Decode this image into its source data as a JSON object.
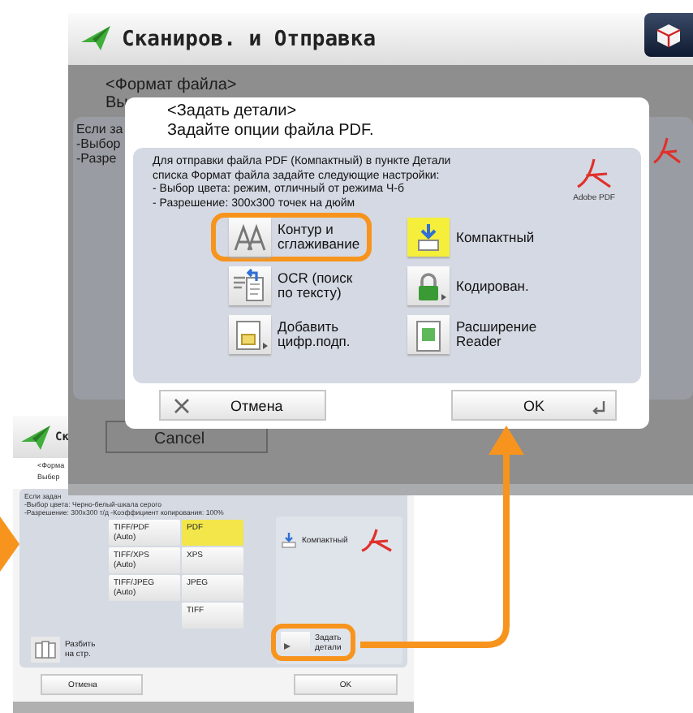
{
  "inset_screen": {
    "title": "Ск",
    "format_label": "<Форма",
    "choose_label": "Выбер",
    "note_lines": [
      "Если задан",
      "-Выбор цвета: Черно-белый-шкала серого",
      "-Разрешение: 300x300 т/д -Коэффициент копирования: 100%"
    ],
    "formats": [
      {
        "label": "TIFF/PDF\n(Auto)",
        "selected": false
      },
      {
        "label": "PDF",
        "selected": true
      },
      {
        "label": "TIFF/XPS\n(Auto)",
        "selected": false
      },
      {
        "label": "XPS",
        "selected": false
      },
      {
        "label": "TIFF/JPEG\n(Auto)",
        "selected": false
      },
      {
        "label": "JPEG",
        "selected": false
      },
      {
        "label": "TIFF",
        "selected": false
      }
    ],
    "compact_label": "Компактный",
    "details_button": {
      "label": "Задать\nдетали",
      "highlighted": true
    },
    "split_button": "Разбить\nна стр.",
    "buttons": [
      {
        "label": "Отмена",
        "kind": "cancel"
      },
      {
        "label": "OK",
        "kind": "ok"
      }
    ]
  },
  "main_screen": {
    "title": "Сканиров. и Отправка",
    "background_texts": [
      "<Формат файла>",
      "Вы"
    ],
    "background_notes": [
      "Если за",
      "-Выбор",
      "-Разре"
    ],
    "background_button": "Cancel",
    "dialog": {
      "heading": "<Задать детали>",
      "subtitle": "Задайте опции файла PDF.",
      "note_lines": [
        "Для отправки файла PDF (Компактный) в пункте Детали",
        "списка Формат файла задайте следующие настройки:",
        "- Выбор цвета: режим, отличный от режима Ч-б",
        "- Разрешение: 300x300 точек на дюйм"
      ],
      "logo_text": "Adobe PDF",
      "options": [
        {
          "label": "Контур и\nсглаживание",
          "kind": "outline",
          "selected": false,
          "highlighted": true
        },
        {
          "label": "Компактный",
          "kind": "compact",
          "selected": true,
          "highlighted": false
        },
        {
          "label": "OCR (поиск\nпо тексту)",
          "kind": "ocr",
          "selected": false,
          "highlighted": false
        },
        {
          "label": "Кодирован.",
          "kind": "encrypt",
          "selected": false,
          "highlighted": false
        },
        {
          "label": "Добавить\nцифр.подп.",
          "kind": "signature",
          "selected": false,
          "highlighted": false
        },
        {
          "label": "Расширение\nReader",
          "kind": "reader",
          "selected": false,
          "highlighted": false
        }
      ],
      "buttons": [
        {
          "label": "Отмена",
          "kind": "cancel"
        },
        {
          "label": "OK",
          "kind": "ok"
        }
      ]
    }
  }
}
